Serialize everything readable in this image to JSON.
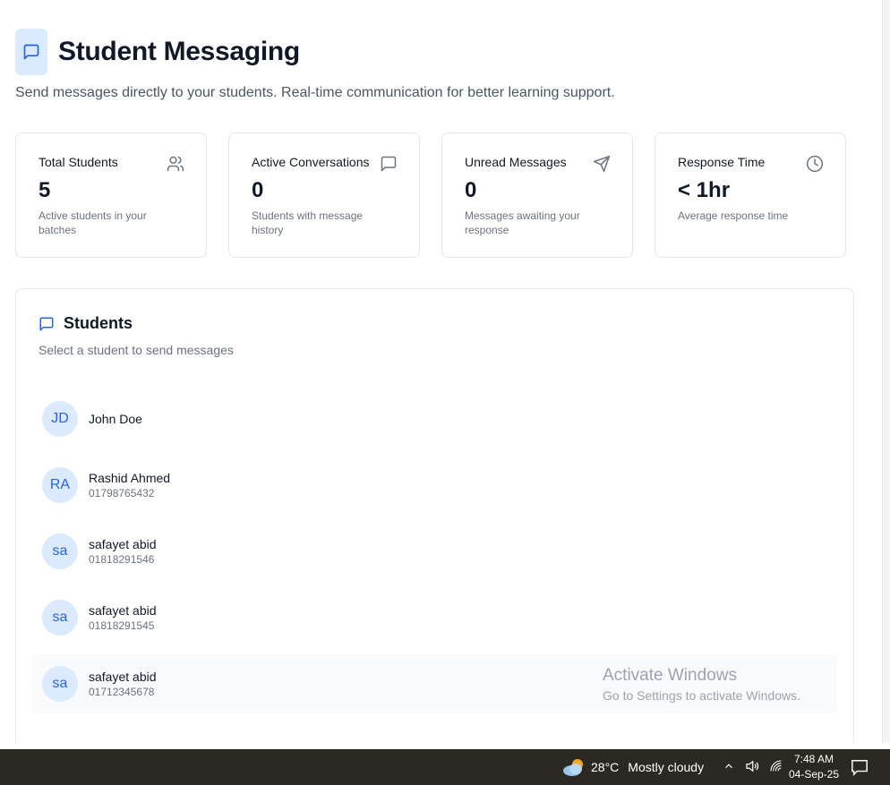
{
  "header": {
    "title": "Student Messaging",
    "subtitle": "Send messages directly to your students. Real-time communication for better learning support."
  },
  "stats": [
    {
      "label": "Total Students",
      "value": "5",
      "description": "Active students in your batches",
      "icon": "users-icon"
    },
    {
      "label": "Active Conversations",
      "value": "0",
      "description": "Students with message history",
      "icon": "message-square-icon"
    },
    {
      "label": "Unread Messages",
      "value": "0",
      "description": "Messages awaiting your response",
      "icon": "send-icon"
    },
    {
      "label": "Response Time",
      "value": "< 1hr",
      "description": "Average response time",
      "icon": "clock-icon"
    }
  ],
  "students_panel": {
    "title": "Students",
    "subtitle": "Select a student to send messages"
  },
  "students": [
    {
      "initials": "JD",
      "name": "John Doe",
      "phone": ""
    },
    {
      "initials": "RA",
      "name": "Rashid Ahmed",
      "phone": "01798765432"
    },
    {
      "initials": "sa",
      "name": "safayet abid",
      "phone": "01818291546"
    },
    {
      "initials": "sa",
      "name": "safayet abid",
      "phone": "01818291545"
    },
    {
      "initials": "sa",
      "name": "safayet abid",
      "phone": "01712345678"
    }
  ],
  "watermark": {
    "title": "Activate Windows",
    "subtitle": "Go to Settings to activate Windows."
  },
  "taskbar": {
    "temperature": "28°C",
    "weather": "Mostly cloudy",
    "time": "7:48 AM",
    "date": "04-Sep-25"
  },
  "colors": {
    "accent": "#2563eb",
    "accent_light": "#dbeafe",
    "border": "#e5e7eb",
    "taskbar": "#2b2a22"
  }
}
